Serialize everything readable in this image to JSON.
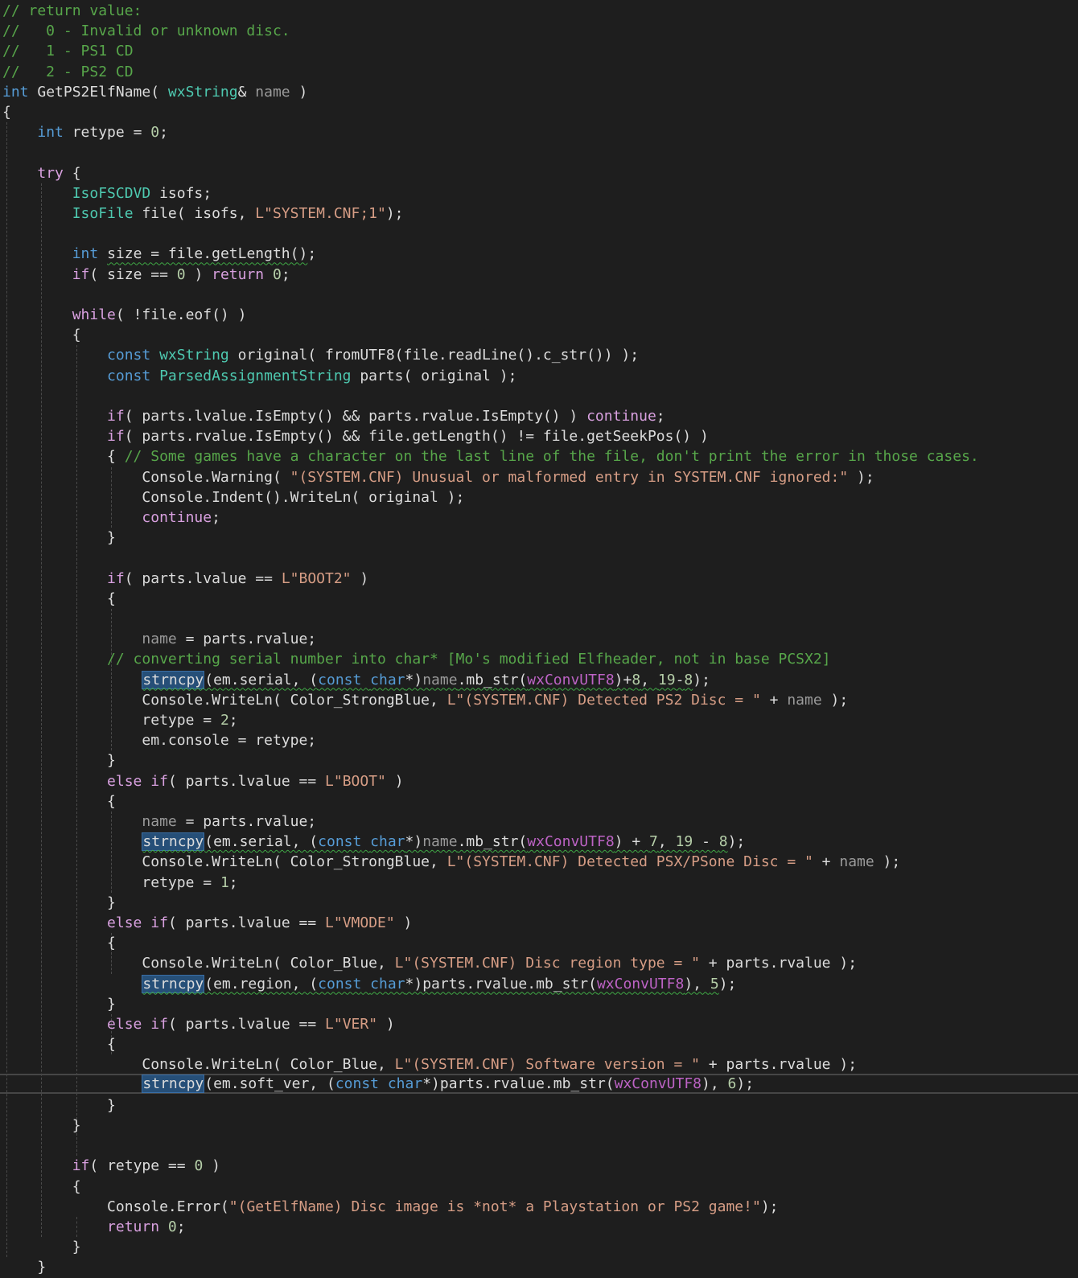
{
  "colors": {
    "background": "#1e1e1e",
    "comment": "#57a64a",
    "keyword": "#569cd6",
    "type": "#4ec9b0",
    "string": "#d69d85",
    "number": "#b5cea8",
    "parameter": "#9a9a9a",
    "macro": "#bd63c5",
    "text": "#dcdcdc",
    "highlight": "#264f78",
    "squiggle": "#3fa845"
  },
  "code_lines": [
    {
      "tokens": [
        {
          "t": "// return value:",
          "c": "comment"
        }
      ]
    },
    {
      "tokens": [
        {
          "t": "//   0 - Invalid or unknown disc.",
          "c": "comment"
        }
      ]
    },
    {
      "tokens": [
        {
          "t": "//   1 - PS1 CD",
          "c": "comment"
        }
      ]
    },
    {
      "tokens": [
        {
          "t": "//   2 - PS2 CD",
          "c": "comment"
        }
      ]
    },
    {
      "tokens": [
        {
          "t": "int",
          "c": "keyword"
        },
        {
          "t": " GetPS2ElfName( ",
          "c": "plain"
        },
        {
          "t": "wxString",
          "c": "type"
        },
        {
          "t": "& ",
          "c": "plain"
        },
        {
          "t": "name",
          "c": "param"
        },
        {
          "t": " )",
          "c": "plain"
        }
      ]
    },
    {
      "tokens": [
        {
          "t": "{",
          "c": "plain"
        }
      ]
    },
    {
      "tokens": [
        {
          "t": "    ",
          "c": "plain"
        },
        {
          "t": "int",
          "c": "keyword"
        },
        {
          "t": " retype = ",
          "c": "plain"
        },
        {
          "t": "0",
          "c": "number"
        },
        {
          "t": ";",
          "c": "plain"
        }
      ]
    },
    {
      "tokens": []
    },
    {
      "tokens": [
        {
          "t": "    ",
          "c": "plain"
        },
        {
          "t": "try",
          "c": "control"
        },
        {
          "t": " {",
          "c": "plain"
        }
      ]
    },
    {
      "tokens": [
        {
          "t": "        ",
          "c": "plain"
        },
        {
          "t": "IsoFSCDVD",
          "c": "type"
        },
        {
          "t": " isofs;",
          "c": "plain"
        }
      ]
    },
    {
      "tokens": [
        {
          "t": "        ",
          "c": "plain"
        },
        {
          "t": "IsoFile",
          "c": "type"
        },
        {
          "t": " file( isofs, ",
          "c": "plain"
        },
        {
          "t": "L\"SYSTEM.CNF;1\"",
          "c": "string"
        },
        {
          "t": ");",
          "c": "plain"
        }
      ]
    },
    {
      "tokens": []
    },
    {
      "tokens": [
        {
          "t": "        ",
          "c": "plain"
        },
        {
          "t": "int",
          "c": "keyword"
        },
        {
          "t": " ",
          "c": "plain"
        },
        {
          "t": "size = file.getLength()",
          "c": "plain",
          "sq": true
        },
        {
          "t": ";",
          "c": "plain"
        }
      ]
    },
    {
      "tokens": [
        {
          "t": "        ",
          "c": "plain"
        },
        {
          "t": "if",
          "c": "control"
        },
        {
          "t": "( size == ",
          "c": "plain"
        },
        {
          "t": "0",
          "c": "number"
        },
        {
          "t": " ) ",
          "c": "plain"
        },
        {
          "t": "return",
          "c": "control"
        },
        {
          "t": " ",
          "c": "plain"
        },
        {
          "t": "0",
          "c": "number"
        },
        {
          "t": ";",
          "c": "plain"
        }
      ]
    },
    {
      "tokens": []
    },
    {
      "tokens": [
        {
          "t": "        ",
          "c": "plain"
        },
        {
          "t": "while",
          "c": "control"
        },
        {
          "t": "( !file.eof() )",
          "c": "plain"
        }
      ]
    },
    {
      "tokens": [
        {
          "t": "        {",
          "c": "plain"
        }
      ]
    },
    {
      "tokens": [
        {
          "t": "            ",
          "c": "plain"
        },
        {
          "t": "const",
          "c": "keyword"
        },
        {
          "t": " ",
          "c": "plain"
        },
        {
          "t": "wxString",
          "c": "type"
        },
        {
          "t": " original( fromUTF8(file.readLine().c_str()) );",
          "c": "plain"
        }
      ]
    },
    {
      "tokens": [
        {
          "t": "            ",
          "c": "plain"
        },
        {
          "t": "const",
          "c": "keyword"
        },
        {
          "t": " ",
          "c": "plain"
        },
        {
          "t": "ParsedAssignmentString",
          "c": "type"
        },
        {
          "t": " parts( original );",
          "c": "plain"
        }
      ]
    },
    {
      "tokens": []
    },
    {
      "tokens": [
        {
          "t": "            ",
          "c": "plain"
        },
        {
          "t": "if",
          "c": "control"
        },
        {
          "t": "( parts.lvalue.IsEmpty() && parts.rvalue.IsEmpty() ) ",
          "c": "plain"
        },
        {
          "t": "continue",
          "c": "control"
        },
        {
          "t": ";",
          "c": "plain"
        }
      ]
    },
    {
      "tokens": [
        {
          "t": "            ",
          "c": "plain"
        },
        {
          "t": "if",
          "c": "control"
        },
        {
          "t": "( parts.rvalue.IsEmpty() && file.getLength() != file.getSeekPos() )",
          "c": "plain"
        }
      ]
    },
    {
      "tokens": [
        {
          "t": "            { ",
          "c": "plain"
        },
        {
          "t": "// Some games have a character on the last line of the file, don't print the error in those cases.",
          "c": "comment"
        }
      ]
    },
    {
      "tokens": [
        {
          "t": "                Console.Warning( ",
          "c": "plain"
        },
        {
          "t": "\"(SYSTEM.CNF) Unusual or malformed entry in SYSTEM.CNF ignored:\"",
          "c": "string"
        },
        {
          "t": " );",
          "c": "plain"
        }
      ]
    },
    {
      "tokens": [
        {
          "t": "                Console.Indent().WriteLn( original );",
          "c": "plain"
        }
      ]
    },
    {
      "tokens": [
        {
          "t": "                ",
          "c": "plain"
        },
        {
          "t": "continue",
          "c": "control"
        },
        {
          "t": ";",
          "c": "plain"
        }
      ]
    },
    {
      "tokens": [
        {
          "t": "            }",
          "c": "plain"
        }
      ]
    },
    {
      "tokens": []
    },
    {
      "tokens": [
        {
          "t": "            ",
          "c": "plain"
        },
        {
          "t": "if",
          "c": "control"
        },
        {
          "t": "( parts.lvalue == ",
          "c": "plain"
        },
        {
          "t": "L\"BOOT2\"",
          "c": "string"
        },
        {
          "t": " )",
          "c": "plain"
        }
      ]
    },
    {
      "tokens": [
        {
          "t": "            {",
          "c": "plain"
        }
      ]
    },
    {
      "tokens": []
    },
    {
      "tokens": [
        {
          "t": "                ",
          "c": "plain"
        },
        {
          "t": "name",
          "c": "param"
        },
        {
          "t": " = parts.rvalue;",
          "c": "plain"
        }
      ]
    },
    {
      "tokens": [
        {
          "t": "            ",
          "c": "plain"
        },
        {
          "t": "// converting serial number into char* [Mo's modified Elfheader, not in base PCSX2]",
          "c": "comment"
        }
      ]
    },
    {
      "tokens": [
        {
          "t": "                ",
          "c": "plain"
        },
        {
          "t": "strncpy",
          "c": "plain",
          "hl": true,
          "sq": true
        },
        {
          "t": "(em.serial, (",
          "c": "plain",
          "sq": true
        },
        {
          "t": "const",
          "c": "keyword",
          "sq": true
        },
        {
          "t": " ",
          "c": "plain",
          "sq": true
        },
        {
          "t": "char",
          "c": "keyword",
          "sq": true
        },
        {
          "t": "*)",
          "c": "plain",
          "sq": true
        },
        {
          "t": "name",
          "c": "param",
          "sq": true
        },
        {
          "t": ".mb_str(",
          "c": "plain",
          "sq": true
        },
        {
          "t": "wxConvUTF8",
          "c": "macro",
          "sq": true
        },
        {
          "t": ")+",
          "c": "plain",
          "sq": true
        },
        {
          "t": "8",
          "c": "number",
          "sq": true
        },
        {
          "t": ", ",
          "c": "plain",
          "sq": true
        },
        {
          "t": "19",
          "c": "number",
          "sq": true
        },
        {
          "t": "-",
          "c": "plain",
          "sq": true
        },
        {
          "t": "8",
          "c": "number",
          "sq": true
        },
        {
          "t": ");",
          "c": "plain"
        }
      ]
    },
    {
      "tokens": [
        {
          "t": "                Console.WriteLn( Color_StrongBlue, ",
          "c": "plain"
        },
        {
          "t": "L\"(SYSTEM.CNF) Detected PS2 Disc = \"",
          "c": "string"
        },
        {
          "t": " + ",
          "c": "plain"
        },
        {
          "t": "name",
          "c": "param"
        },
        {
          "t": " );",
          "c": "plain"
        }
      ]
    },
    {
      "tokens": [
        {
          "t": "                retype = ",
          "c": "plain"
        },
        {
          "t": "2",
          "c": "number"
        },
        {
          "t": ";",
          "c": "plain"
        }
      ]
    },
    {
      "tokens": [
        {
          "t": "                em.console = retype;",
          "c": "plain"
        }
      ]
    },
    {
      "tokens": [
        {
          "t": "            }",
          "c": "plain"
        }
      ]
    },
    {
      "tokens": [
        {
          "t": "            ",
          "c": "plain"
        },
        {
          "t": "else",
          "c": "control"
        },
        {
          "t": " ",
          "c": "plain"
        },
        {
          "t": "if",
          "c": "control"
        },
        {
          "t": "( parts.lvalue == ",
          "c": "plain"
        },
        {
          "t": "L\"BOOT\"",
          "c": "string"
        },
        {
          "t": " )",
          "c": "plain"
        }
      ]
    },
    {
      "tokens": [
        {
          "t": "            {",
          "c": "plain"
        }
      ]
    },
    {
      "tokens": [
        {
          "t": "                ",
          "c": "plain"
        },
        {
          "t": "name",
          "c": "param"
        },
        {
          "t": " = parts.rvalue;",
          "c": "plain"
        }
      ]
    },
    {
      "tokens": [
        {
          "t": "                ",
          "c": "plain"
        },
        {
          "t": "strncpy",
          "c": "plain",
          "hl": true,
          "sq": true
        },
        {
          "t": "(em.serial, (",
          "c": "plain",
          "sq": true
        },
        {
          "t": "const",
          "c": "keyword",
          "sq": true
        },
        {
          "t": " ",
          "c": "plain",
          "sq": true
        },
        {
          "t": "char",
          "c": "keyword",
          "sq": true
        },
        {
          "t": "*)",
          "c": "plain",
          "sq": true
        },
        {
          "t": "name",
          "c": "param",
          "sq": true
        },
        {
          "t": ".mb_str(",
          "c": "plain",
          "sq": true
        },
        {
          "t": "wxConvUTF8",
          "c": "macro",
          "sq": true
        },
        {
          "t": ") + ",
          "c": "plain",
          "sq": true
        },
        {
          "t": "7",
          "c": "number",
          "sq": true
        },
        {
          "t": ", ",
          "c": "plain",
          "sq": true
        },
        {
          "t": "19",
          "c": "number",
          "sq": true
        },
        {
          "t": " - ",
          "c": "plain",
          "sq": true
        },
        {
          "t": "8",
          "c": "number",
          "sq": true
        },
        {
          "t": ");",
          "c": "plain"
        }
      ]
    },
    {
      "tokens": [
        {
          "t": "                Console.WriteLn( Color_StrongBlue, ",
          "c": "plain"
        },
        {
          "t": "L\"(SYSTEM.CNF) Detected PSX/PSone Disc = \"",
          "c": "string"
        },
        {
          "t": " + ",
          "c": "plain"
        },
        {
          "t": "name",
          "c": "param"
        },
        {
          "t": " );",
          "c": "plain"
        }
      ]
    },
    {
      "tokens": [
        {
          "t": "                retype = ",
          "c": "plain"
        },
        {
          "t": "1",
          "c": "number"
        },
        {
          "t": ";",
          "c": "plain"
        }
      ]
    },
    {
      "tokens": [
        {
          "t": "            }",
          "c": "plain"
        }
      ]
    },
    {
      "tokens": [
        {
          "t": "            ",
          "c": "plain"
        },
        {
          "t": "else",
          "c": "control"
        },
        {
          "t": " ",
          "c": "plain"
        },
        {
          "t": "if",
          "c": "control"
        },
        {
          "t": "( parts.lvalue == ",
          "c": "plain"
        },
        {
          "t": "L\"VMODE\"",
          "c": "string"
        },
        {
          "t": " )",
          "c": "plain"
        }
      ]
    },
    {
      "tokens": [
        {
          "t": "            {",
          "c": "plain"
        }
      ]
    },
    {
      "tokens": [
        {
          "t": "                Console.WriteLn( Color_Blue, ",
          "c": "plain"
        },
        {
          "t": "L\"(SYSTEM.CNF) Disc region type = \"",
          "c": "string"
        },
        {
          "t": " + parts.rvalue );",
          "c": "plain"
        }
      ]
    },
    {
      "tokens": [
        {
          "t": "                ",
          "c": "plain"
        },
        {
          "t": "strncpy",
          "c": "plain",
          "hl": true,
          "sq": true
        },
        {
          "t": "(em.region, (",
          "c": "plain",
          "sq": true
        },
        {
          "t": "const",
          "c": "keyword",
          "sq": true
        },
        {
          "t": " ",
          "c": "plain",
          "sq": true
        },
        {
          "t": "char",
          "c": "keyword",
          "sq": true
        },
        {
          "t": "*)parts.rvalue.mb_str(",
          "c": "plain",
          "sq": true
        },
        {
          "t": "wxConvUTF8",
          "c": "macro",
          "sq": true
        },
        {
          "t": "), ",
          "c": "plain",
          "sq": true
        },
        {
          "t": "5",
          "c": "number",
          "sq": true
        },
        {
          "t": ");",
          "c": "plain"
        }
      ]
    },
    {
      "tokens": [
        {
          "t": "            }",
          "c": "plain"
        }
      ]
    },
    {
      "tokens": [
        {
          "t": "            ",
          "c": "plain"
        },
        {
          "t": "else",
          "c": "control"
        },
        {
          "t": " ",
          "c": "plain"
        },
        {
          "t": "if",
          "c": "control"
        },
        {
          "t": "( parts.lvalue == ",
          "c": "plain"
        },
        {
          "t": "L\"VER\"",
          "c": "string"
        },
        {
          "t": " )",
          "c": "plain"
        }
      ]
    },
    {
      "tokens": [
        {
          "t": "            {",
          "c": "plain"
        }
      ]
    },
    {
      "tokens": [
        {
          "t": "                Console.WriteLn( Color_Blue, ",
          "c": "plain"
        },
        {
          "t": "L\"(SYSTEM.CNF) Software version = \"",
          "c": "string"
        },
        {
          "t": " + parts.rvalue );",
          "c": "plain"
        }
      ]
    },
    {
      "tokens": [
        {
          "t": "                ",
          "c": "plain"
        },
        {
          "t": "strncpy",
          "c": "plain",
          "hl": true
        },
        {
          "t": "(em.soft_ver, (",
          "c": "plain"
        },
        {
          "t": "const",
          "c": "keyword"
        },
        {
          "t": " ",
          "c": "plain"
        },
        {
          "t": "char",
          "c": "keyword"
        },
        {
          "t": "*)parts.rvalue.mb_str(",
          "c": "plain"
        },
        {
          "t": "wxConvUTF8",
          "c": "macro"
        },
        {
          "t": "), ",
          "c": "plain"
        },
        {
          "t": "6",
          "c": "number"
        },
        {
          "t": ");",
          "c": "plain"
        }
      ],
      "current": true
    },
    {
      "tokens": [
        {
          "t": "            }",
          "c": "plain"
        }
      ]
    },
    {
      "tokens": [
        {
          "t": "        }",
          "c": "plain"
        }
      ]
    },
    {
      "tokens": []
    },
    {
      "tokens": [
        {
          "t": "        ",
          "c": "plain"
        },
        {
          "t": "if",
          "c": "control"
        },
        {
          "t": "( retype == ",
          "c": "plain"
        },
        {
          "t": "0",
          "c": "number"
        },
        {
          "t": " )",
          "c": "plain"
        }
      ]
    },
    {
      "tokens": [
        {
          "t": "        {",
          "c": "plain"
        }
      ]
    },
    {
      "tokens": [
        {
          "t": "            Console.Error(",
          "c": "plain"
        },
        {
          "t": "\"(GetElfName) Disc image is *not* a Playstation or PS2 game!\"",
          "c": "string"
        },
        {
          "t": ");",
          "c": "plain"
        }
      ]
    },
    {
      "tokens": [
        {
          "t": "            ",
          "c": "plain"
        },
        {
          "t": "return",
          "c": "control"
        },
        {
          "t": " ",
          "c": "plain"
        },
        {
          "t": "0",
          "c": "number"
        },
        {
          "t": ";",
          "c": "plain"
        }
      ]
    },
    {
      "tokens": [
        {
          "t": "        }",
          "c": "plain"
        }
      ]
    },
    {
      "tokens": [
        {
          "t": "    }",
          "c": "plain"
        }
      ]
    }
  ]
}
